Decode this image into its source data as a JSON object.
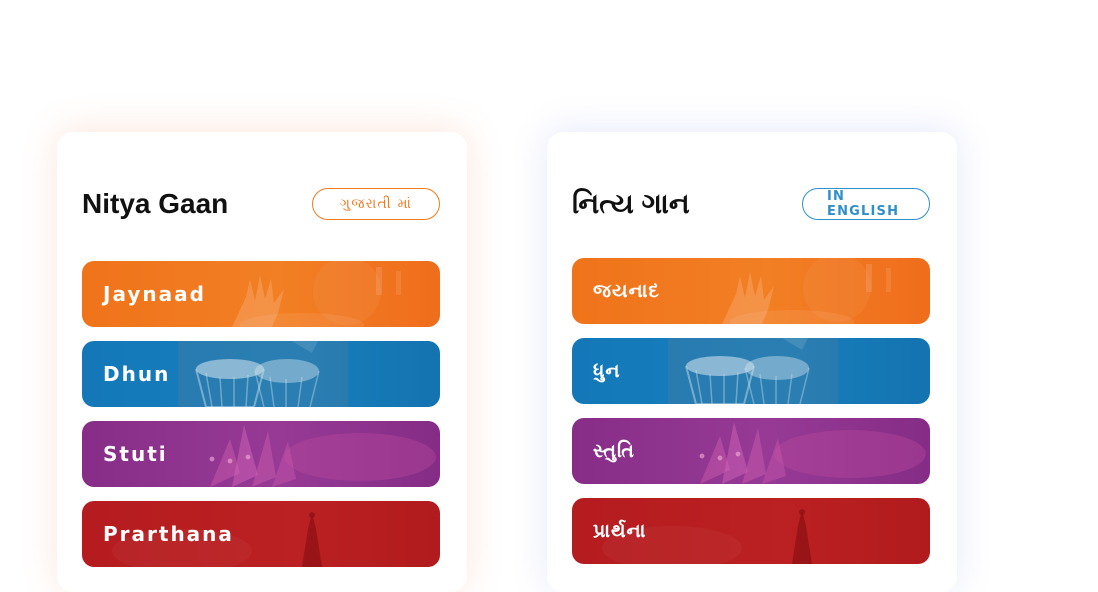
{
  "colors": {
    "orange": "#f0731a",
    "blue": "#1478b8",
    "purple": "#872d87",
    "red": "#b51c1f",
    "lang_left": "#ef7a1f",
    "lang_right": "#2f8fc9"
  },
  "cards": [
    {
      "title": "Nitya Gaan",
      "lang_button": "ગુજરાતી માં",
      "items": [
        {
          "label": "Jaynaad",
          "color": "orange",
          "image": "hands-tabla-photo"
        },
        {
          "label": "Dhun",
          "color": "blue",
          "image": "tabla-drums-photo"
        },
        {
          "label": "Stuti",
          "color": "purple",
          "image": "lotus-flower-photo"
        },
        {
          "label": "Prarthana",
          "color": "red",
          "image": "folded-hands-photo"
        }
      ]
    },
    {
      "title": "નિત્ય ગાન",
      "lang_button": "IN ENGLISH",
      "items": [
        {
          "label": "જયનાદ",
          "color": "orange",
          "image": "hands-tabla-photo"
        },
        {
          "label": "ધુન",
          "color": "blue",
          "image": "tabla-drums-photo"
        },
        {
          "label": "સ્તુતિ",
          "color": "purple",
          "image": "lotus-flower-photo"
        },
        {
          "label": "પ્રાર્થના",
          "color": "red",
          "image": "folded-hands-photo"
        }
      ]
    }
  ]
}
